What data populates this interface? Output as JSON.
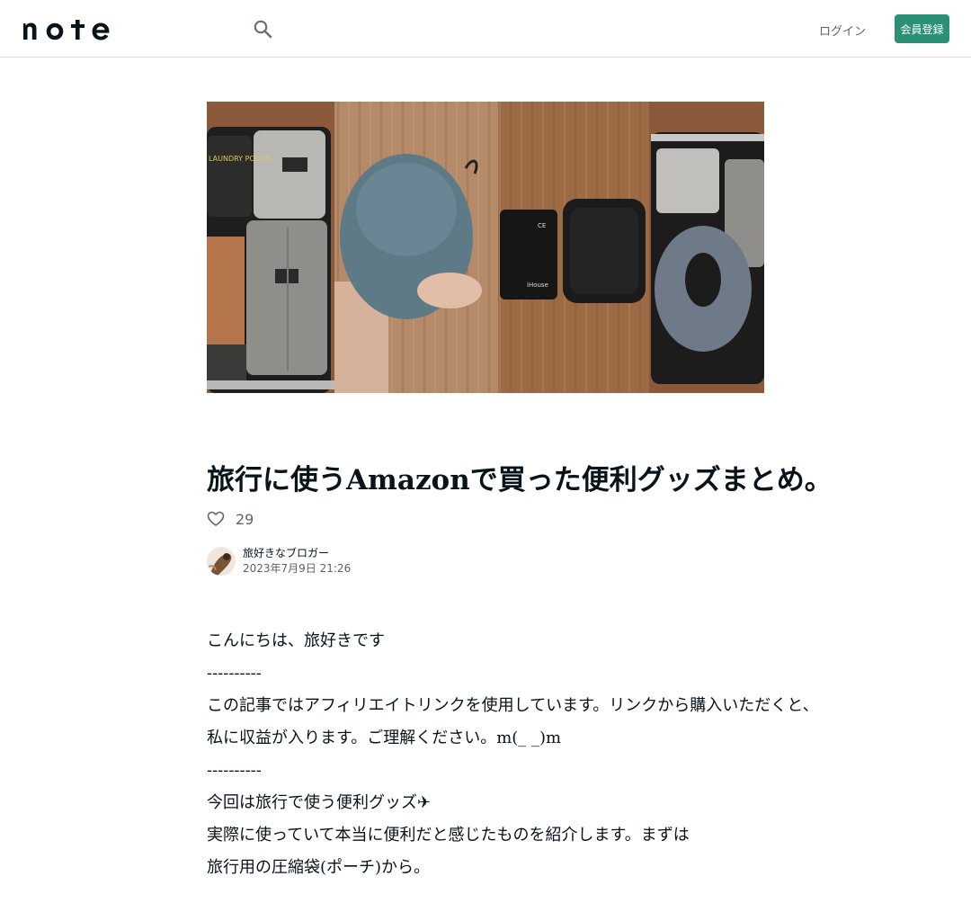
{
  "header": {
    "logo_text": "note",
    "search_icon": "search-icon",
    "login_label": "ログイン",
    "signup_label": "会員登録",
    "accent_color": "#2b9076"
  },
  "article": {
    "title": "旅行に使うAmazonで買った便利グッズまとめ。",
    "like_count": "29",
    "author_name": "旅好きなブロガー",
    "date": "2023年7月9日 21:26",
    "body_lines": [
      "こんにちは、旅好きです",
      "----------",
      "この記事ではアフィリエイトリンクを使用しています。リンクから購入いただくと、",
      "私に収益が入ります。ご理解ください。m(_ _)m",
      "----------",
      "今回は旅行で使う便利グッズ✈",
      "実際に使っていて本当に便利だと感じたものを紹介します。まずは",
      "旅行用の圧縮袋(ポーチ)から。"
    ]
  },
  "eyecatch": {
    "panel_labels": [
      "LAUNDRY POUCH",
      "iHouse",
      "CE"
    ]
  }
}
